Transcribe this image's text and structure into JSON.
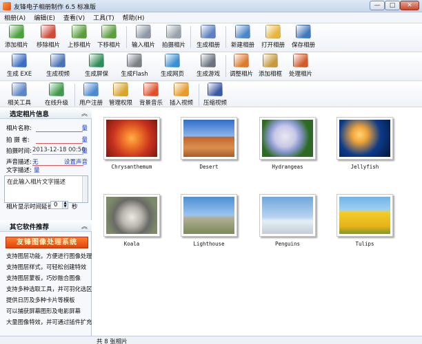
{
  "window": {
    "title": "友锋电子相册制作 6.5 标准版",
    "minimize": "—",
    "maximize": "□",
    "close": "✕"
  },
  "menu": [
    "相册(A)",
    "编辑(E)",
    "查看(V)",
    "工具(T)",
    "帮助(H)"
  ],
  "toolbar1": [
    {
      "label": "添加相片",
      "icon": "add-photo-icon",
      "color": "#4aa23a"
    },
    {
      "label": "移除相片",
      "icon": "remove-photo-icon",
      "color": "#d04a3a"
    },
    {
      "label": "上移相片",
      "icon": "move-up-icon",
      "color": "#5a9f3c"
    },
    {
      "label": "下移相片",
      "icon": "move-down-icon",
      "color": "#5a9f3c"
    },
    {
      "label": "输入相片",
      "icon": "scanner-icon",
      "color": "#8e98a6"
    },
    {
      "label": "拍摄相片",
      "icon": "webcam-icon",
      "color": "#9aa3ad"
    },
    {
      "label": "生成相册",
      "icon": "make-album-icon",
      "color": "#5b7fc4"
    },
    {
      "label": "新建相册",
      "icon": "new-album-icon",
      "color": "#4a86c8"
    },
    {
      "label": "打开相册",
      "icon": "open-folder-icon",
      "color": "#e8b43a"
    },
    {
      "label": "保存相册",
      "icon": "save-album-icon",
      "color": "#3e78c0"
    }
  ],
  "toolbar2": [
    {
      "label": "生成 EXE",
      "icon": "exe-icon",
      "color": "#3a6fc4"
    },
    {
      "label": "生成视频",
      "icon": "video-icon",
      "color": "#4a74b8"
    },
    {
      "label": "生成屏保",
      "icon": "screensaver-icon",
      "color": "#2f8f5a"
    },
    {
      "label": "生成Flash",
      "icon": "flash-icon",
      "color": "#7a7f88"
    },
    {
      "label": "生成网页",
      "icon": "webpage-icon",
      "color": "#3a8fd4"
    },
    {
      "label": "生成游戏",
      "icon": "gamepad-icon",
      "color": "#6b7380"
    },
    {
      "label": "调整相片",
      "icon": "adjust-photo-icon",
      "color": "#e07a2a"
    },
    {
      "label": "添加相框",
      "icon": "add-frame-icon",
      "color": "#c79a3a"
    },
    {
      "label": "处理相片",
      "icon": "process-photo-icon",
      "color": "#d45a2a"
    }
  ],
  "toolbar3": [
    {
      "label": "相关工具",
      "icon": "tools-icon",
      "color": "#5b86c8"
    },
    {
      "label": "在线升级",
      "icon": "upgrade-icon",
      "color": "#3f9a4a"
    },
    {
      "label": "用户注册",
      "icon": "register-icon",
      "color": "#4a8ad0"
    },
    {
      "label": "管理权限",
      "icon": "permission-icon",
      "color": "#d8a42a"
    },
    {
      "label": "背景音乐",
      "icon": "music-icon",
      "color": "#e0502a"
    },
    {
      "label": "插入视频",
      "icon": "insert-video-icon",
      "color": "#e89a2a"
    },
    {
      "label": "压缩视频",
      "icon": "compress-video-icon",
      "color": "#3a5aa8"
    }
  ],
  "photo_info": {
    "title": "选定相片信息",
    "collapse": "︽",
    "name_label": "相片名称:",
    "name_value": "",
    "photographer_label": "拍 摄 者:",
    "photographer_value": "",
    "time_label": "拍摄时间:",
    "time_value": "2013-12-18 00:50:",
    "save": "量",
    "voice_label": "声音描述:",
    "voice_value": "无",
    "voice_action": "设置声音",
    "text_label": "文字描述:",
    "text_save": "量",
    "text_placeholder": "在此输入相片文字描述",
    "delay_label": "相片显示时间延长:",
    "delay_value": "0",
    "delay_unit": "秒"
  },
  "other_software": {
    "title": "其它软件推荐",
    "collapse": "︽",
    "banner": "友锋图像处理系统",
    "lines": [
      "支持图层功能，方便进行图像处理",
      "支持图层样式，可轻松创建特效",
      "支持图层蒙板，巧妙融合图像",
      "支持多种选取工具，并可羽化选区",
      "提供日历及多种卡片等模板",
      "可以捕获屏幕图形及电影屏幕",
      "大量图像特效，并可通过插件扩充"
    ]
  },
  "photos": [
    {
      "caption": "Chrysanthemum",
      "theme": "flower-red",
      "c1": "#c8321e",
      "c2": "#f07a2a"
    },
    {
      "caption": "Desert",
      "theme": "desert",
      "c1": "#2f6fc9",
      "c2": "#c4632e"
    },
    {
      "caption": "Hydrangeas",
      "theme": "hydrangea",
      "c1": "#e8e8f4",
      "c2": "#2f6a24"
    },
    {
      "caption": "Jellyfish",
      "theme": "jellyfish",
      "c1": "#0d3b8a",
      "c2": "#f0a53a"
    },
    {
      "caption": "Koala",
      "theme": "koala",
      "c1": "#7c8a6a",
      "c2": "#b9b6ae"
    },
    {
      "caption": "Lighthouse",
      "theme": "lighthouse",
      "c1": "#4d8fd4",
      "c2": "#7a8a5a"
    },
    {
      "caption": "Penguins",
      "theme": "penguins",
      "c1": "#6fa7dc",
      "c2": "#e6eef5"
    },
    {
      "caption": "Tulips",
      "theme": "tulips",
      "c1": "#f2cf2a",
      "c2": "#6fb4e8"
    }
  ],
  "status": {
    "text": "共 8 张相片"
  }
}
